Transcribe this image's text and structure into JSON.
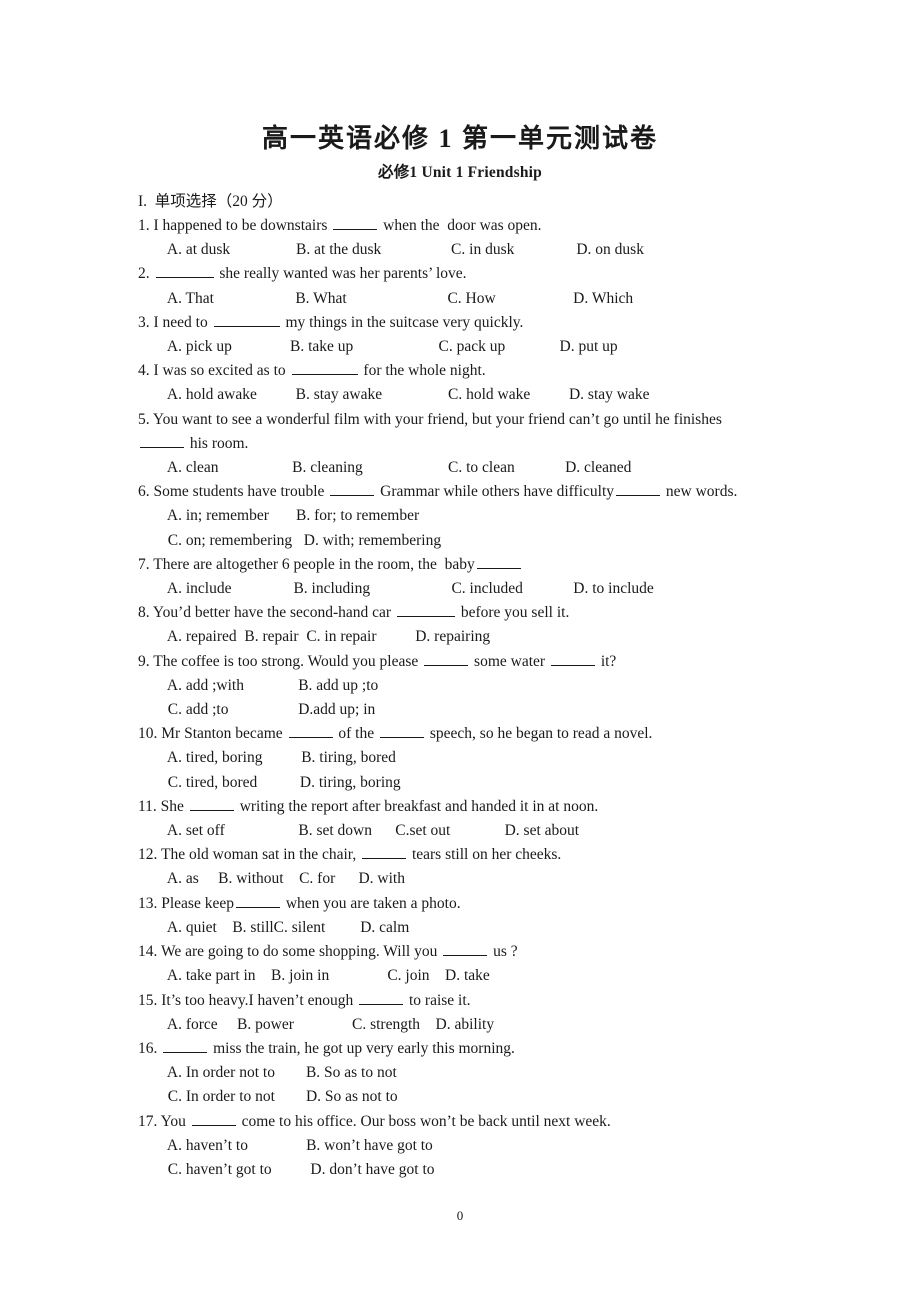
{
  "document": {
    "title": "高一英语必修 1 第一单元测试卷",
    "subtitle": "必修1      Unit 1 Friendship",
    "page_number": "0"
  },
  "section": {
    "heading": "I.  单项选择（20 分）"
  },
  "questions": [
    {
      "num": "1.",
      "stem_a": "1. I happened to be downstairs ",
      "stem_b": " when the  door was open.",
      "options": "  A. at dusk                 B. at the dusk                  C. in dusk                D. on dusk"
    },
    {
      "num": "2.",
      "stem_a": "2. ",
      "stem_b": " she really wanted was her parents’ love.",
      "options": "  A. That                     B. What                          C. How                    D. Which"
    },
    {
      "num": "3.",
      "stem_a": "3. I need to ",
      "stem_b": " my things in the suitcase very quickly.",
      "options": "  A. pick up               B. take up                      C. pack up              D. put up"
    },
    {
      "num": "4.",
      "stem_a": "4. I was so excited as to ",
      "stem_b": " for the whole night.",
      "options": "  A. hold awake          B. stay awake                 C. hold wake          D. stay wake"
    },
    {
      "num": "5.",
      "stem_wrap": "5. You want to see a wonderful film with your friend, but your friend can’t go until he finishes",
      "cont_b": " his room.",
      "options": "  A. clean                   B. cleaning                      C. to clean             D. cleaned"
    },
    {
      "num": "6.",
      "stem_a": "6. Some students have trouble ",
      "stem_mid": " Grammar while others have difficulty",
      "stem_b": " new words.",
      "options_1": "  A. in; remember       B. for; to remember",
      "options_2": "  C. on; remembering   D. with; remembering"
    },
    {
      "num": "7.",
      "stem_a": "7. There are altogether 6 people in the room, the  baby",
      "options": "  A. include                B. including                     C. included             D. to include"
    },
    {
      "num": "8.",
      "stem_a": "8. You’d better have the second-hand car ",
      "stem_b": " before you sell it.",
      "options": "  A. repaired  B. repair  C. in repair          D. repairing"
    },
    {
      "num": "9.",
      "stem_a": "9. The coffee is too strong. Would you please ",
      "stem_mid": " some water ",
      "stem_b": " it?",
      "options_1": "  A. add ;with              B. add up ;to",
      "options_2": "  C. add ;to                  D.add up; in"
    },
    {
      "num": "10.",
      "stem_a": "10. Mr Stanton became ",
      "stem_mid": " of the ",
      "stem_b": " speech, so he began to read a novel.",
      "options_1": "  A. tired, boring          B. tiring, bored",
      "options_2": "  C. tired, bored           D. tiring, boring"
    },
    {
      "num": "11.",
      "stem_a": "11. She ",
      "stem_b": " writing the report after breakfast and handed it in at noon.",
      "options": "  A. set off                   B. set down      C.set out              D. set about"
    },
    {
      "num": "12.",
      "stem_a": "12. The old woman sat in the chair, ",
      "stem_b": " tears still on her cheeks.",
      "options": "  A. as     B. without    C. for      D. with"
    },
    {
      "num": "13.",
      "stem_a": "13. Please keep",
      "stem_b": " when you are taken a photo.",
      "options": "  A. quiet    B. stillC. silent         D. calm"
    },
    {
      "num": "14.",
      "stem_a": "14. We are going to do some shopping. Will you ",
      "stem_b": " us ?",
      "options": "  A. take part in    B. join in               C. join    D. take"
    },
    {
      "num": "15.",
      "stem_a": "15. It’s too heavy.I haven’t enough ",
      "stem_b": " to raise it.",
      "options": "  A. force     B. power               C. strength    D. ability"
    },
    {
      "num": "16.",
      "stem_a": "16. ",
      "stem_b": " miss the train, he got up very early this morning.",
      "options_1": "  A. In order not to        B. So as to not",
      "options_2": "  C. In order to not        D. So as not to"
    },
    {
      "num": "17.",
      "stem_a": "17. You ",
      "stem_b": " come to his office. Our boss won’t be back until next week.",
      "options_1": "  A. haven’t to               B. won’t have got to",
      "options_2": "  C. haven’t got to          D. don’t have got to"
    }
  ]
}
